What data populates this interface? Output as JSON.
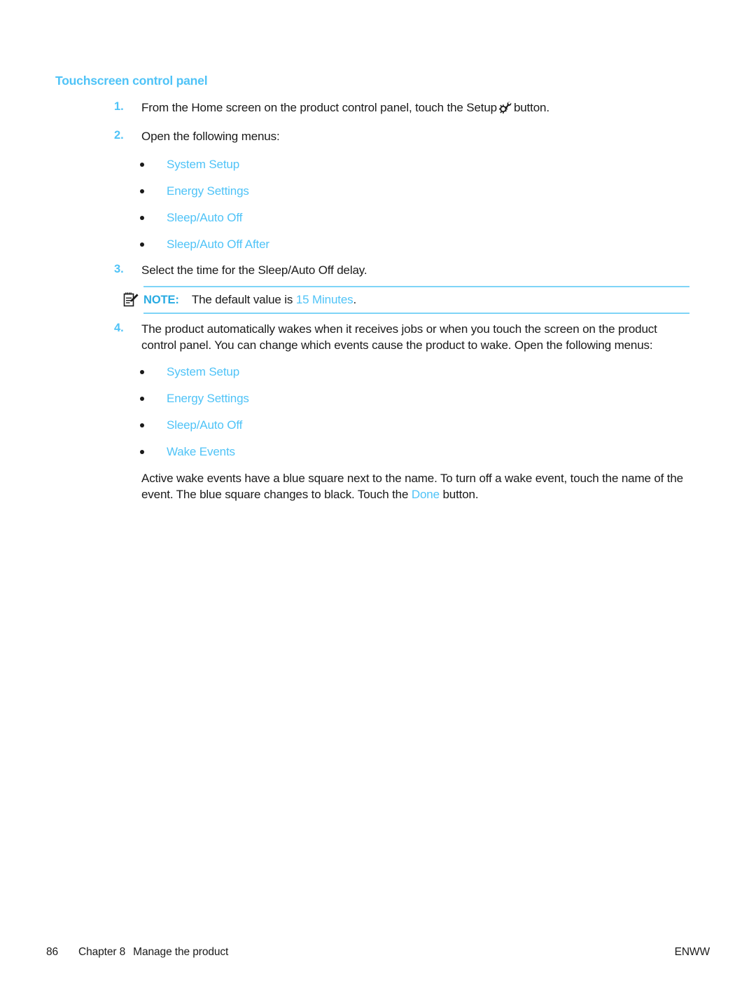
{
  "heading": "Touchscreen control panel",
  "steps": [
    {
      "number": "1.",
      "text_before": "From the Home screen on the product control panel, touch the Setup",
      "icon": "setup-wrench-gear-icon",
      "text_after": "button."
    },
    {
      "number": "2.",
      "text": "Open the following menus:"
    },
    {
      "number": "3.",
      "text": "Select the time for the Sleep/Auto Off delay."
    },
    {
      "number": "4.",
      "text": "The product automatically wakes when it receives jobs or when you touch the screen on the product control panel. You can change which events cause the product to wake. Open the following menus:"
    }
  ],
  "menu_list_1": [
    "System Setup",
    "Energy Settings",
    "Sleep/Auto Off",
    "Sleep/Auto Off After"
  ],
  "menu_list_2": [
    "System Setup",
    "Energy Settings",
    "Sleep/Auto Off",
    "Wake Events"
  ],
  "note": {
    "icon": "note-pad-pencil-icon",
    "label": "NOTE:",
    "text_before": "The default value is",
    "value": "15 Minutes",
    "text_after": "."
  },
  "closing_paragraph": {
    "part1": "Active wake events have a blue square next to the name. To turn off a wake event, touch the name of the event. The blue square changes to black. Touch the",
    "emphasis": "Done",
    "part2": "button."
  },
  "footer": {
    "page_number": "86",
    "chapter": "Chapter 8",
    "chapter_title": "Manage the product",
    "right": "ENWW"
  },
  "colors": {
    "accent_blue": "#4FC3F7",
    "note_blue": "#29ABE2",
    "rule_blue": "#7FD4F7",
    "text": "#1a1a1a"
  }
}
